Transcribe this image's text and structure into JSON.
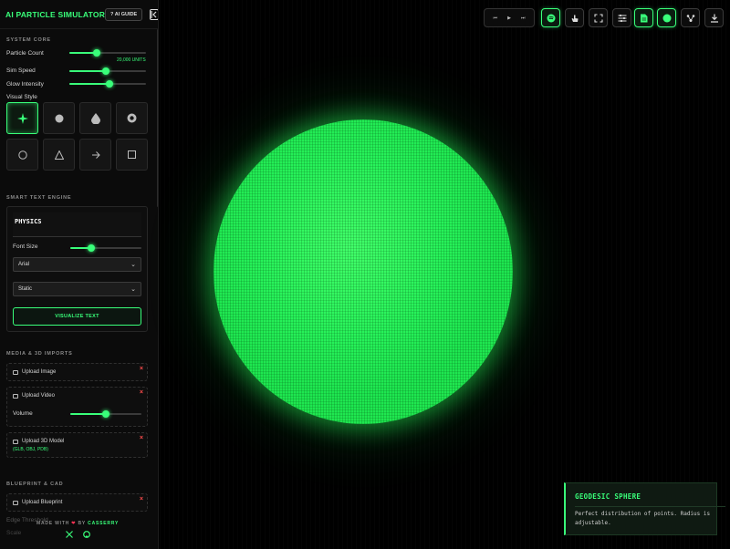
{
  "app": {
    "title": "AI PARTICLE SIMULATOR",
    "guide_label": "? AI GUIDE"
  },
  "colors": {
    "accent": "#39ff7a",
    "danger": "#ff4d4d",
    "background": "#000000"
  },
  "system_core": {
    "title": "SYSTEM CORE",
    "particle_count_label": "Particle Count",
    "particle_units": "20,000 UNITS",
    "particle_count_level": 0.36,
    "sim_speed_label": "Sim Speed",
    "sim_speed_level": 0.48,
    "glow_label": "Glow Intensity",
    "glow_level": 0.52,
    "visual_style_label": "Visual Style",
    "styles": [
      "sparkle-icon",
      "circle-filled-icon",
      "droplet-icon",
      "target-icon",
      "circle-outline-icon",
      "triangle-icon",
      "arrow-right-icon",
      "square-icon"
    ]
  },
  "text_engine": {
    "title": "SMART TEXT ENGINE",
    "text_value": "PHYSICS",
    "font_size_label": "Font Size",
    "font_size_level": 0.3,
    "font_select": "Arial",
    "mode_select": "Static",
    "visualize_label": "VISUALIZE TEXT"
  },
  "media": {
    "title": "MEDIA & 3D IMPORTS",
    "upload_image": "Upload Image",
    "upload_video": "Upload Video",
    "volume_label": "Volume",
    "volume_level": 0.5,
    "upload_model": "Upload 3D Model",
    "model_formats": "(GLB, OBJ, PDB)"
  },
  "blueprint": {
    "title": "BLUEPRINT & CAD",
    "upload_blueprint": "Upload Blueprint",
    "edge_threshold_label": "Edge Threshold",
    "scale_label": "Scale"
  },
  "footer": {
    "made_with": "MADE WITH",
    "by": "BY",
    "brand": "CASSERRY"
  },
  "info": {
    "title": "GEODESIC SPHERE",
    "description": "Perfect distribution of points. Radius is adjustable."
  }
}
